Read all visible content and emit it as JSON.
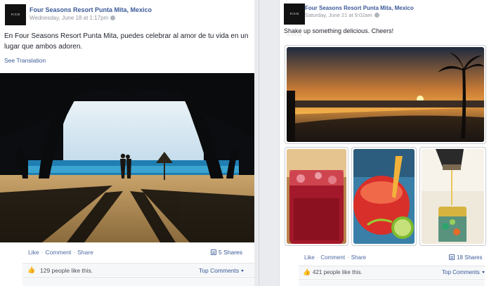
{
  "posts": [
    {
      "page_name": "Four Seasons Resort Punta Mita, Mexico",
      "avatar_text": "FOUR SEASONS",
      "timestamp": "Wednesday, June 18 at 1:17pm",
      "text": "En Four Seasons Resort Punta Mita, puedes celebrar al amor de tu vida en un lugar que ambos adoren.",
      "see_translation": "See Translation",
      "actions": {
        "like": "Like",
        "comment": "Comment",
        "share": "Share"
      },
      "shares": "5 Shares",
      "likes": "129 people like this.",
      "top_comments": "Top Comments"
    },
    {
      "page_name": "Four Seasons Resort Punta Mita, Mexico",
      "avatar_text": "FOUR SEASONS",
      "timestamp": "Saturday, June 21 at 9:02am",
      "text": "Shake up something delicious. Cheers!",
      "actions": {
        "like": "Like",
        "comment": "Comment",
        "share": "Share"
      },
      "shares": "18 Shares",
      "likes": "421 people like this.",
      "top_comments": "Top Comments"
    }
  ],
  "icons": {
    "globe": "globe-icon",
    "share": "share-icon",
    "like": "thumbs-up-icon",
    "dropdown": "chevron-down-icon"
  },
  "colors": {
    "link": "#3b5998",
    "meta": "#90949c",
    "text": "#1d2129",
    "background": "#e9ebee"
  }
}
